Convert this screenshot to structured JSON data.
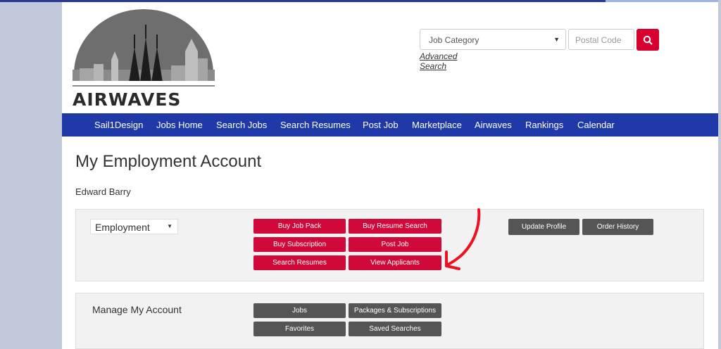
{
  "header": {
    "logo_text": "AIRWAVES",
    "search": {
      "category_value": "Job Category",
      "postal_placeholder": "Postal Code",
      "advanced_link": "Advanced Search"
    }
  },
  "nav": {
    "items": [
      {
        "label": "Sail1Design"
      },
      {
        "label": "Jobs Home"
      },
      {
        "label": "Search Jobs"
      },
      {
        "label": "Search Resumes"
      },
      {
        "label": "Post Job"
      },
      {
        "label": "Marketplace"
      },
      {
        "label": "Airwaves"
      },
      {
        "label": "Rankings"
      },
      {
        "label": "Calendar"
      }
    ]
  },
  "main": {
    "title": "My Employment Account",
    "user_name": "Edward Barry",
    "employment_select": "Employment",
    "employment_buttons": [
      "Buy Job Pack",
      "Buy Resume Search",
      "Buy Subscription",
      "Post Job",
      "Search Resumes",
      "View Applicants"
    ],
    "profile_buttons": [
      "Update Profile",
      "Order History"
    ],
    "manage_title": "Manage My Account",
    "manage_buttons": [
      "Jobs",
      "Packages & Subscriptions",
      "Favorites",
      "Saved Searches"
    ]
  },
  "colors": {
    "nav": "#1f3aa8",
    "red_button": "#d0093a",
    "dark_button": "#555555",
    "annotation": "#ee1122"
  }
}
